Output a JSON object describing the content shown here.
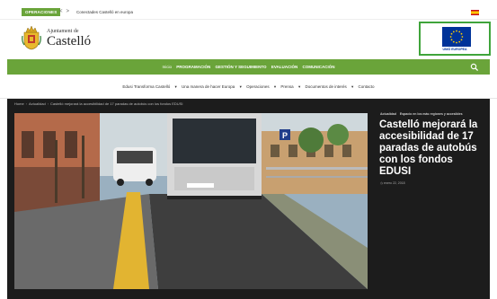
{
  "topbar": {
    "badge": "OPERACIONES",
    "prev_arrow": "<",
    "next_arrow": ">",
    "ticker": "Conectades Castelló en europa",
    "flag_icon": "spain-flag-icon"
  },
  "header": {
    "logo_small": "Ajuntament de",
    "logo_big": "Castelló",
    "eu_label": "UNIÓ EUROPEA",
    "eu_flag_color": "#003399",
    "eu_box_border": "#3fa43b"
  },
  "mainnav": {
    "background": "#6aa43a",
    "items": [
      "Inicio",
      "PROGRAMACIÓN",
      "GESTIÓN Y SEGUIMIENTO",
      "EVALUACIÓN",
      "COMUNICACIÓN"
    ],
    "search_icon": "search-icon"
  },
  "subnav": {
    "items": [
      "Edusi Transforma Castelló",
      "Una manera de hacer Europa",
      "Operaciones",
      "Prensa",
      "Documentos de interés",
      "Contacto"
    ]
  },
  "breadcrumb": {
    "items": [
      "Home",
      "Actualidad",
      "Castelló mejorará la accesibilidad de 17 paradas de autobús con los fondos EDUSI"
    ]
  },
  "article": {
    "categories": [
      "Actualidad",
      "Espacio en los más regiones y accesibles"
    ],
    "title": "Castelló mejorará la accesibilidad de 17 paradas de autobús con los fondos EDUSI",
    "date": "enero 22, 2018"
  }
}
